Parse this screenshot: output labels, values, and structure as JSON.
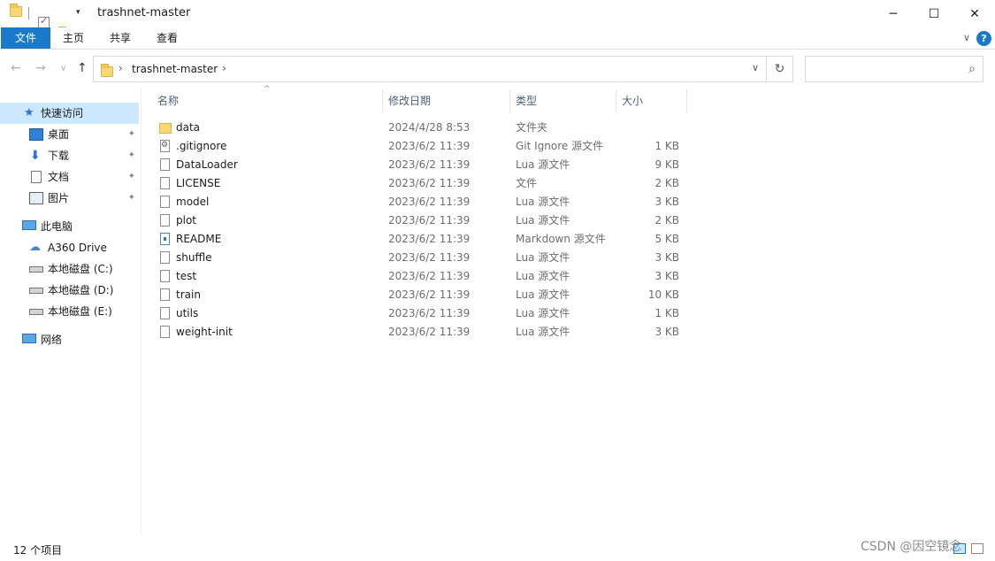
{
  "window": {
    "title": "trashnet-master",
    "qa_dropdown": "▾",
    "minimize": "─",
    "maximize": "☐",
    "close": "✕"
  },
  "ribbon": {
    "tabs": [
      "文件",
      "主页",
      "共享",
      "查看"
    ],
    "chevron": "∨",
    "help": "?"
  },
  "nav": {
    "back": "←",
    "forward": "→",
    "recent": "∨",
    "up": "↑",
    "sep": "›",
    "path": "trashnet-master",
    "sep2": "›",
    "dropdown": "∨",
    "refresh": "↻",
    "search_placeholder": "",
    "search_icon": "⌕"
  },
  "sidebar": {
    "quick_access": "快速访问",
    "quick_items": [
      {
        "label": "桌面",
        "icon": "desktop-icon"
      },
      {
        "label": "下载",
        "icon": "download-icon"
      },
      {
        "label": "文档",
        "icon": "document-icon"
      },
      {
        "label": "图片",
        "icon": "picture-icon"
      }
    ],
    "pin_glyph": "📌",
    "this_pc": "此电脑",
    "pc_items": [
      "A360 Drive",
      "本地磁盘 (C:)",
      "本地磁盘 (D:)",
      "本地磁盘 (E:)"
    ],
    "network": "网络"
  },
  "columns": {
    "name": "名称",
    "date": "修改日期",
    "type": "类型",
    "size": "大小",
    "sort_arrow": "^"
  },
  "files": [
    {
      "name": "data",
      "date": "2024/4/28 8:53",
      "type": "文件夹",
      "size": "",
      "icon": "folder"
    },
    {
      "name": ".gitignore",
      "date": "2023/6/2 11:39",
      "type": "Git Ignore 源文件",
      "size": "1 KB",
      "icon": "gear"
    },
    {
      "name": "DataLoader",
      "date": "2023/6/2 11:39",
      "type": "Lua 源文件",
      "size": "9 KB",
      "icon": "file"
    },
    {
      "name": "LICENSE",
      "date": "2023/6/2 11:39",
      "type": "文件",
      "size": "2 KB",
      "icon": "file"
    },
    {
      "name": "model",
      "date": "2023/6/2 11:39",
      "type": "Lua 源文件",
      "size": "3 KB",
      "icon": "file"
    },
    {
      "name": "plot",
      "date": "2023/6/2 11:39",
      "type": "Lua 源文件",
      "size": "2 KB",
      "icon": "file"
    },
    {
      "name": "README",
      "date": "2023/6/2 11:39",
      "type": "Markdown 源文件",
      "size": "5 KB",
      "icon": "md"
    },
    {
      "name": "shuffle",
      "date": "2023/6/2 11:39",
      "type": "Lua 源文件",
      "size": "3 KB",
      "icon": "file"
    },
    {
      "name": "test",
      "date": "2023/6/2 11:39",
      "type": "Lua 源文件",
      "size": "3 KB",
      "icon": "file"
    },
    {
      "name": "train",
      "date": "2023/6/2 11:39",
      "type": "Lua 源文件",
      "size": "10 KB",
      "icon": "file"
    },
    {
      "name": "utils",
      "date": "2023/6/2 11:39",
      "type": "Lua 源文件",
      "size": "1 KB",
      "icon": "file"
    },
    {
      "name": "weight-init",
      "date": "2023/6/2 11:39",
      "type": "Lua 源文件",
      "size": "3 KB",
      "icon": "file"
    }
  ],
  "status": {
    "count": "12 个项目",
    "watermark": "CSDN @因空镜念"
  }
}
